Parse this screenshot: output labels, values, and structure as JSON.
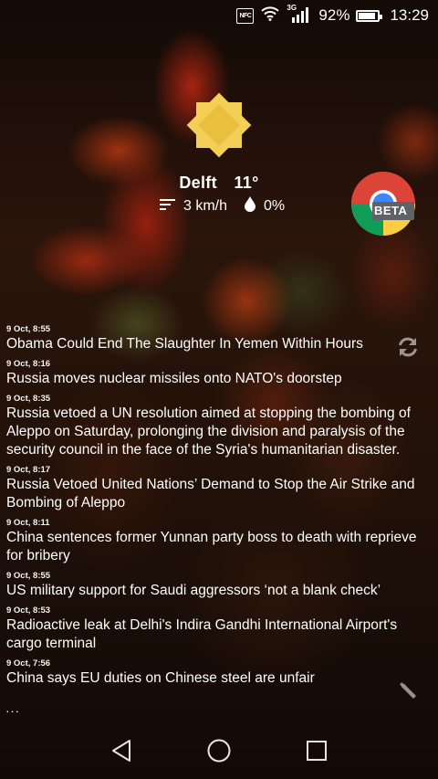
{
  "status_bar": {
    "network": "3G",
    "battery": "92%",
    "battery_level": 0.92,
    "time": "13:29",
    "nfc_label": "NFC",
    "icons": [
      "nfc-icon",
      "wifi-icon",
      "signal-icon",
      "battery-icon"
    ]
  },
  "weather": {
    "city": "Delft",
    "temperature": "11°",
    "wind": "3 km/h",
    "precipitation": "0%",
    "icon": "sun-icon",
    "sun_color": "#f3cf55"
  },
  "chrome_beta": {
    "badge": "BETA",
    "icon": "chrome-beta-icon"
  },
  "news": [
    {
      "date": "9 Oct, 8:55",
      "title": "Obama Could End The Slaughter In Yemen Within Hours"
    },
    {
      "date": "9 Oct, 8:16",
      "title": "Russia moves nuclear missiles onto NATO's doorstep"
    },
    {
      "date": "9 Oct, 8:35",
      "title": "Russia vetoed a UN resolution aimed at stopping the bombing of Aleppo on Saturday, prolonging the division and paralysis of the security council in the face of the Syria's humanitarian disaster."
    },
    {
      "date": "9 Oct, 8:17",
      "title": "Russia Vetoed United Nations’ Demand to Stop the Air Strike and Bombing of Aleppo"
    },
    {
      "date": "9 Oct, 8:11",
      "title": "China sentences former Yunnan party boss to death with reprieve for bribery"
    },
    {
      "date": "9 Oct, 8:55",
      "title": "US military support for Saudi aggressors ‘not a blank check’"
    },
    {
      "date": "9 Oct, 8:53",
      "title": "Radioactive leak at Delhi's Indira Gandhi International Airport's cargo terminal"
    },
    {
      "date": "9 Oct, 7:56",
      "title": "China says EU duties on Chinese steel are unfair"
    }
  ],
  "widget_icons": [
    "refresh-icon",
    "wrench-icon"
  ],
  "nav_bar": {
    "icons": [
      "back-icon",
      "home-icon",
      "recents-icon"
    ]
  }
}
